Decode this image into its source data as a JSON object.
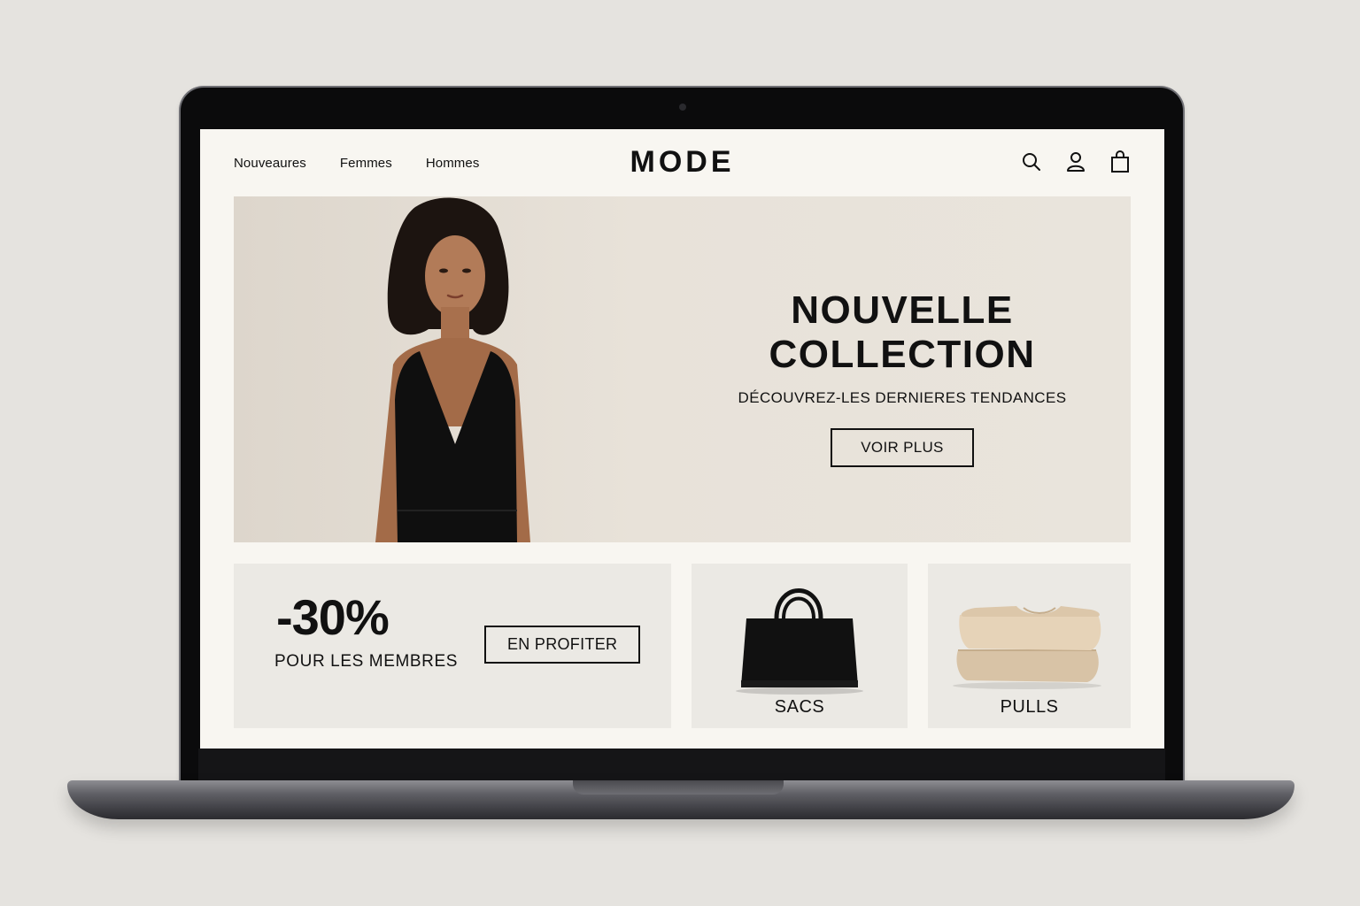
{
  "header": {
    "nav": [
      "Nouveaures",
      "Femmes",
      "Hommes"
    ],
    "logo": "MODE",
    "icons": [
      "search-icon",
      "account-icon",
      "shopping-bag-icon"
    ]
  },
  "hero": {
    "title_line1": "NOUVELLE",
    "title_line2": "COLLECTION",
    "subtitle": "DÉCOUVREZ-LES DERNIERES TENDANCES",
    "cta": "VOIR PLUS"
  },
  "promo": {
    "value": "-30%",
    "label": "POUR LES MEMBRES",
    "cta": "EN PROFITER"
  },
  "categories": [
    {
      "label": "SACS",
      "icon": "handbag-image"
    },
    {
      "label": "PULLS",
      "icon": "sweater-image"
    }
  ],
  "colors": {
    "page_bg": "#f8f6f1",
    "hero_bg": "#e8e2d9",
    "card_bg": "#ebe9e4",
    "text": "#111111"
  }
}
